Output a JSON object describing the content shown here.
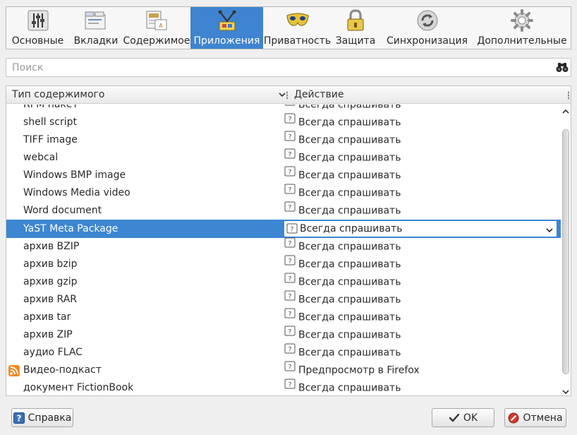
{
  "toolbar": {
    "items": [
      {
        "label": "Основные",
        "icon": "sliders-icon"
      },
      {
        "label": "Вкладки",
        "icon": "tabs-icon"
      },
      {
        "label": "Содержимое",
        "icon": "content-icon"
      },
      {
        "label": "Приложения",
        "icon": "applications-icon",
        "active": true
      },
      {
        "label": "Приватность",
        "icon": "mask-icon"
      },
      {
        "label": "Защита",
        "icon": "padlock-icon"
      },
      {
        "label": "Синхронизация",
        "icon": "sync-icon"
      },
      {
        "label": "Дополнительные",
        "icon": "gear-icon"
      }
    ],
    "active_color": "#3e84d0"
  },
  "search": {
    "placeholder": "Поиск",
    "value": ""
  },
  "table": {
    "columns": {
      "type": "Тип содержимого",
      "action": "Действие"
    },
    "rows": [
      {
        "type": "RPM пакет",
        "action": "Всегда спрашивать"
      },
      {
        "type": "shell script",
        "action": "Всегда спрашивать"
      },
      {
        "type": "TIFF image",
        "action": "Всегда спрашивать"
      },
      {
        "type": "webcal",
        "action": "Всегда спрашивать"
      },
      {
        "type": "Windows BMP image",
        "action": "Всегда спрашивать"
      },
      {
        "type": "Windows Media video",
        "action": "Всегда спрашивать"
      },
      {
        "type": "Word document",
        "action": "Всегда спрашивать"
      },
      {
        "type": "YaST Meta Package",
        "action": "Всегда спрашивать",
        "selected": true
      },
      {
        "type": "архив BZIP",
        "action": "Всегда спрашивать"
      },
      {
        "type": "архив bzip",
        "action": "Всегда спрашивать"
      },
      {
        "type": "архив gzip",
        "action": "Всегда спрашивать"
      },
      {
        "type": "архив RAR",
        "action": "Всегда спрашивать"
      },
      {
        "type": "архив tar",
        "action": "Всегда спрашивать"
      },
      {
        "type": "архив ZIP",
        "action": "Всегда спрашивать"
      },
      {
        "type": "аудио FLAC",
        "action": "Всегда спрашивать"
      },
      {
        "type": "Видео-подкаст",
        "action": "Предпросмотр в Firefox",
        "feed": true
      },
      {
        "type": "документ FictionBook",
        "action": "Всегда спрашивать"
      }
    ],
    "selection_color": "#3d86d1"
  },
  "scroll": {
    "position": 0.55,
    "visible_fraction": 0.9
  },
  "buttons": {
    "help": "Справка",
    "ok": "OK",
    "cancel": "Отмена"
  }
}
